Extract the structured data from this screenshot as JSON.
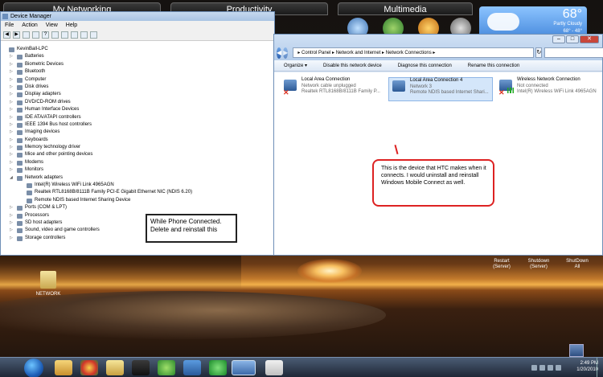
{
  "desktop_groups": [
    "My Networking",
    "Productivity",
    "Multimedia"
  ],
  "weather": {
    "temp": "68°",
    "condition": "Partly Cloudy",
    "range": "68° - 48°"
  },
  "device_manager": {
    "title": "Device Manager",
    "menu": [
      "File",
      "Action",
      "View",
      "Help"
    ],
    "root": "KevinBall-LPC",
    "categories_top": [
      "Batteries",
      "Biometric Devices",
      "Bluetooth",
      "Computer",
      "Disk drives",
      "Display adapters",
      "DVD/CD-ROM drives",
      "Human Interface Devices",
      "IDE ATA/ATAPI controllers",
      "IEEE 1394 Bus host controllers",
      "Imaging devices",
      "Keyboards",
      "Memory technology driver",
      "Mice and other pointing devices",
      "Modems",
      "Monitors",
      "Network adapters"
    ],
    "network_children": [
      "Intel(R) Wireless WiFi Link 4965AGN",
      "Realtek RTL8168B/8111B Family PCI-E Gigabit Ethernet NIC (NDIS 6.20)",
      "Remote NDIS based Internet Sharing Device"
    ],
    "categories_bottom": [
      "Ports (COM & LPT)",
      "Processors",
      "SD host adapters",
      "Sound, video and game controllers",
      "Storage controllers"
    ],
    "callout": "While Phone Connected. Delete and reinstall this"
  },
  "network_connections": {
    "breadcrumb": "▸ Control Panel ▸ Network and Internet ▸ Network Connections ▸",
    "commands": [
      "Organize ▾",
      "Disable this network device",
      "Diagnose this connection",
      "Rename this connection"
    ],
    "connections": [
      {
        "name": "Local Area Connection",
        "status": "Network cable unplugged",
        "adapter": "Realtek RTL8168B/8111B Family P..."
      },
      {
        "name": "Local Area Connection 4",
        "status": "Network 3",
        "adapter": "Remote NDIS based Internet Shari..."
      },
      {
        "name": "Wireless Network Connection",
        "status": "Not connected",
        "adapter": "Intel(R) Wireless WiFi Link 4965AGN"
      }
    ],
    "callout": "This is the device that HTC makes when it connects. I would uninstall and reinstall Windows Mobile Connect as well."
  },
  "shutdown_gadget": [
    {
      "line1": "Restart",
      "line2": "(Server)"
    },
    {
      "line1": "Shutdown",
      "line2": "(Server)"
    },
    {
      "line1": "ShutDown",
      "line2": "All"
    }
  ],
  "desktop_icon": "NETWORK",
  "clock": {
    "time": "2:49 PM",
    "date": "1/20/2010"
  }
}
